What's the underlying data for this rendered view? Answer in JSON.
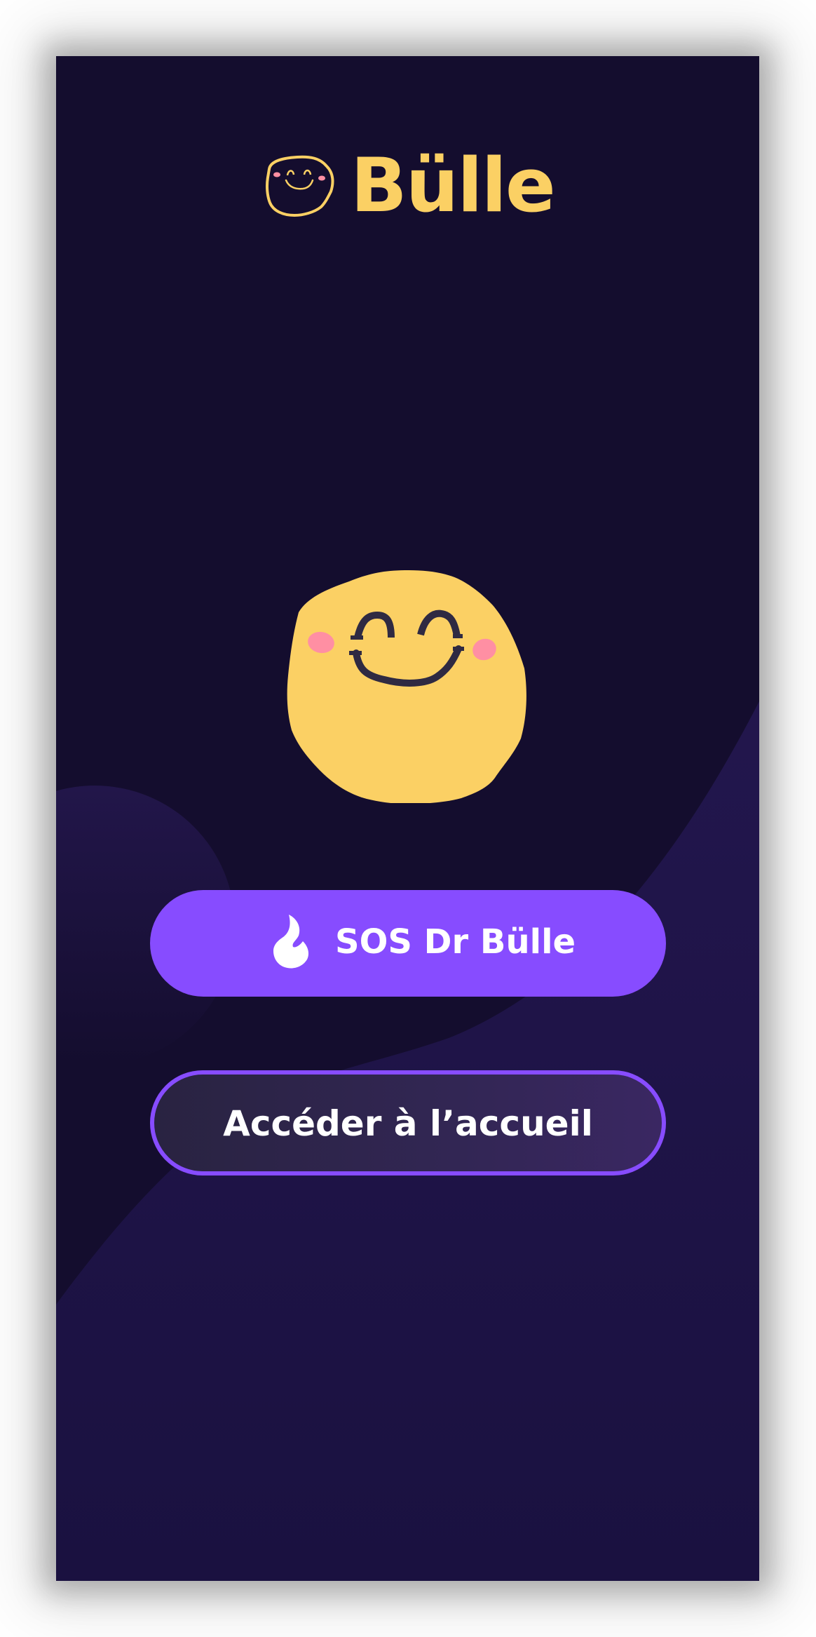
{
  "app": {
    "name": "Bülle"
  },
  "logo": {
    "icon": "smiley-face-icon"
  },
  "mascot": {
    "icon": "smiling-blob-mascot"
  },
  "actions": {
    "sos_label": "SOS Dr Bülle",
    "sos_icon": "flame-icon",
    "home_label": "Accéder à l’accueil"
  },
  "colors": {
    "background": "#140d2e",
    "brand_yellow": "#fbd064",
    "accent_purple": "#874cff",
    "blush_pink": "#ff8fa3"
  }
}
